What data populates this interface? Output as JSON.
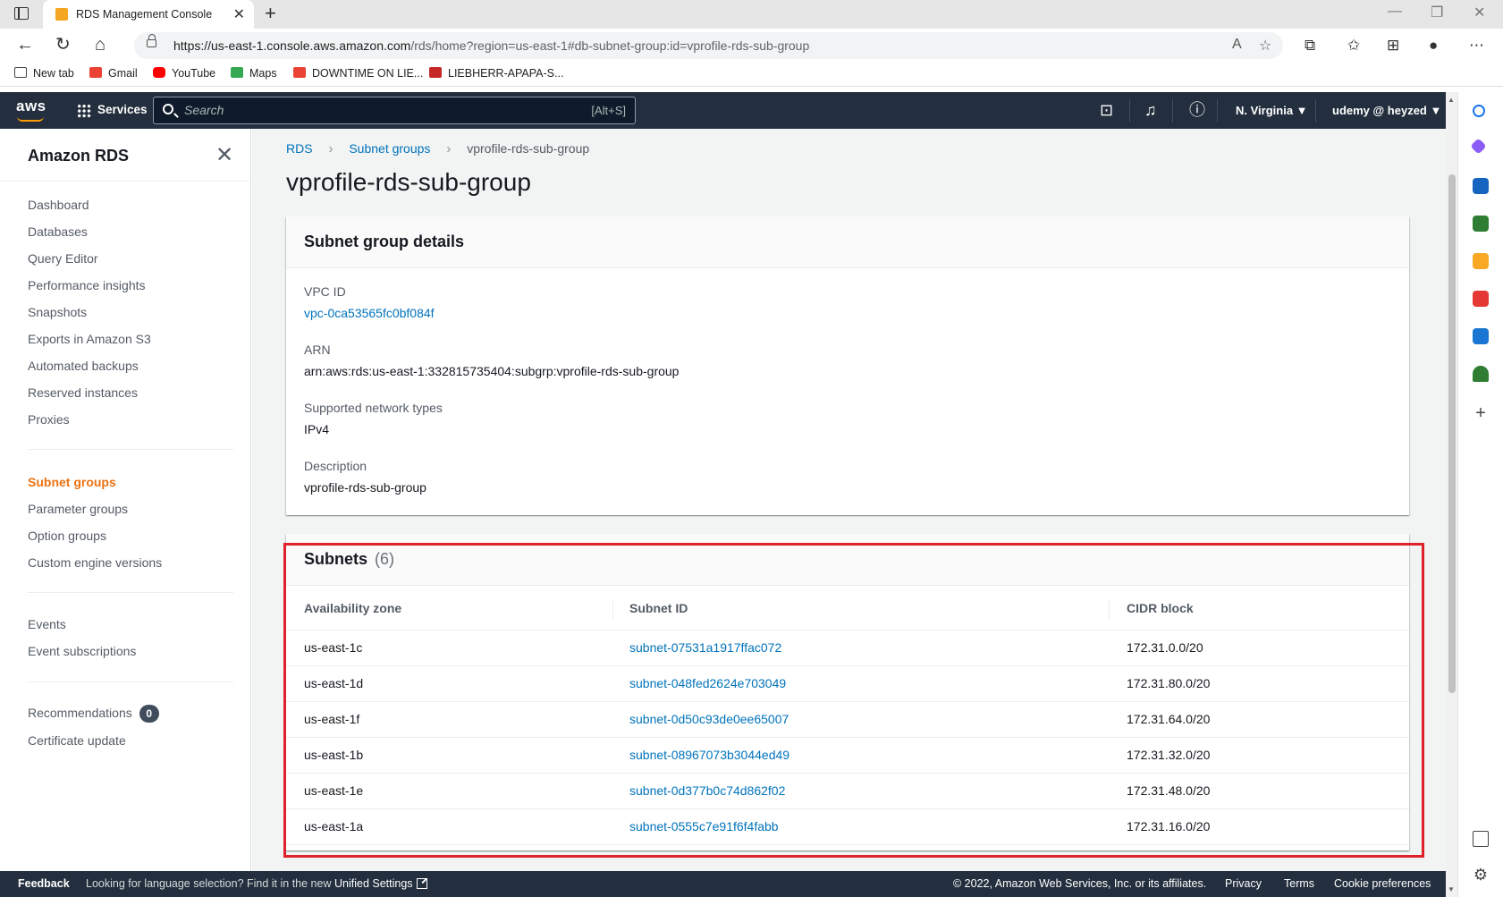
{
  "browser": {
    "tab_title": "RDS Management Console",
    "url_host": "https://us-east-1.console.aws.amazon.com",
    "url_path": "/rds/home?region=us-east-1#db-subnet-group:id=vprofile-rds-sub-group",
    "bookmarks": [
      "New tab",
      "Gmail",
      "YouTube",
      "Maps",
      "DOWNTIME ON LIE...",
      "LIEBHERR-APAPA-S..."
    ],
    "window_controls": [
      "—",
      "❐",
      "✕"
    ]
  },
  "aws_nav": {
    "logo": "aws",
    "services_label": "Services",
    "search_placeholder": "Search",
    "search_shortcut": "[Alt+S]",
    "region": "N. Virginia ▼",
    "account": "udemy @ heyzed ▼"
  },
  "sidebar": {
    "title": "Amazon RDS",
    "close_glyph": "✕",
    "items": [
      "Dashboard",
      "Databases",
      "Query Editor",
      "Performance insights",
      "Snapshots",
      "Exports in Amazon S3",
      "Automated backups",
      "Reserved instances",
      "Proxies"
    ],
    "items2": [
      "Subnet groups",
      "Parameter groups",
      "Option groups",
      "Custom engine versions"
    ],
    "items3": [
      "Events",
      "Event subscriptions"
    ],
    "recommendations_label": "Recommendations",
    "recommendations_count": "0",
    "certificate_label": "Certificate update",
    "active_item": "Subnet groups"
  },
  "breadcrumb": {
    "items": [
      "RDS",
      "Subnet groups",
      "vprofile-rds-sub-group"
    ]
  },
  "page_title": "vprofile-rds-sub-group",
  "details": {
    "title": "Subnet group details",
    "vpc_label": "VPC ID",
    "vpc_value": "vpc-0ca53565fc0bf084f",
    "arn_label": "ARN",
    "arn_value": "arn:aws:rds:us-east-1:332815735404:subgrp:vprofile-rds-sub-group",
    "network_label": "Supported network types",
    "network_value": "IPv4",
    "description_label": "Description",
    "description_value": "vprofile-rds-sub-group"
  },
  "subnets": {
    "title": "Subnets",
    "count": "(6)",
    "columns": [
      "Availability zone",
      "Subnet ID",
      "CIDR block"
    ],
    "rows": [
      [
        "us-east-1c",
        "subnet-07531a1917ffac072",
        "172.31.0.0/20"
      ],
      [
        "us-east-1d",
        "subnet-048fed2624e703049",
        "172.31.80.0/20"
      ],
      [
        "us-east-1f",
        "subnet-0d50c93de0ee65007",
        "172.31.64.0/20"
      ],
      [
        "us-east-1b",
        "subnet-08967073b3044ed49",
        "172.31.32.0/20"
      ],
      [
        "us-east-1e",
        "subnet-0d377b0c74d862f02",
        "172.31.48.0/20"
      ],
      [
        "us-east-1a",
        "subnet-0555c7e91f6f4fabb",
        "172.31.16.0/20"
      ]
    ]
  },
  "footer": {
    "feedback": "Feedback",
    "language_text": "Looking for language selection? Find it in the new",
    "unified_settings": "Unified Settings",
    "copyright": "© 2022, Amazon Web Services, Inc. or its affiliates.",
    "privacy": "Privacy",
    "terms": "Terms",
    "cookies": "Cookie preferences"
  },
  "colors": {
    "aws_nav_bg": "#232f3e",
    "link": "#0073bb",
    "active_orange": "#ec7211",
    "highlight_red": "#e0202a"
  }
}
